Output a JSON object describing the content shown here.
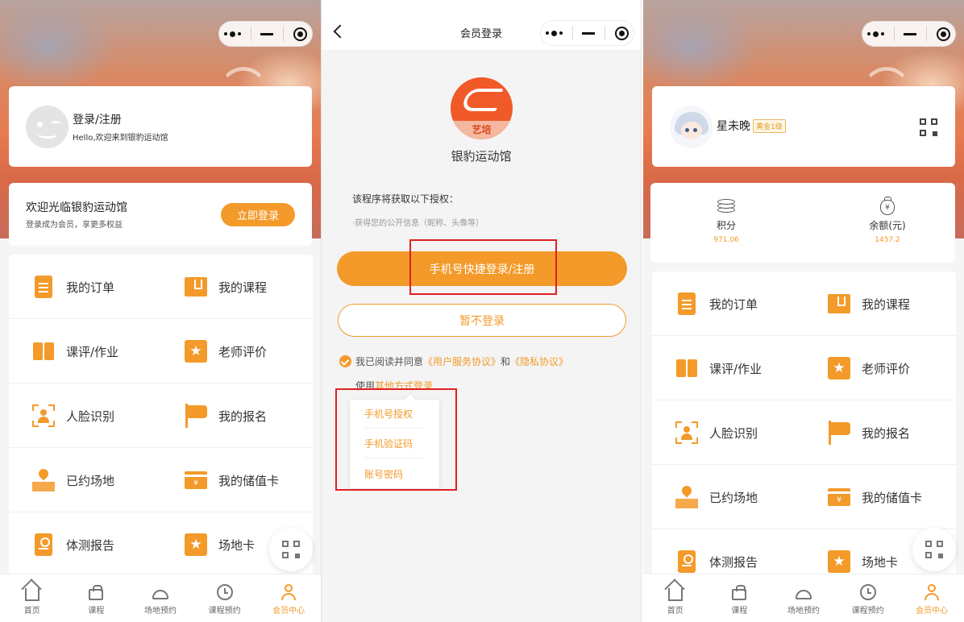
{
  "capsule": {
    "more_icon": "more-dots-icon",
    "minimize_icon": "minimize-icon",
    "close_icon": "target-close-icon"
  },
  "colors": {
    "accent": "#f39a2a",
    "highlight_box": "#e02020"
  },
  "left": {
    "user": {
      "name": "登录/注册",
      "subtitle": "Hello,欢迎来到银豹运动馆"
    },
    "welcome": {
      "title": "欢迎光临银豹运动馆",
      "subtitle": "登录成为会员，享更多权益",
      "button": "立即登录"
    }
  },
  "menu": [
    {
      "label": "我的订单",
      "icon": "order-list-icon"
    },
    {
      "label": "我的课程",
      "icon": "course-book-icon"
    },
    {
      "label": "课评/作业",
      "icon": "open-book-icon"
    },
    {
      "label": "老师评价",
      "icon": "star-icon"
    },
    {
      "label": "人脸识别",
      "icon": "face-scan-icon"
    },
    {
      "label": "我的报名",
      "icon": "flag-icon"
    },
    {
      "label": "已约场地",
      "icon": "map-pin-icon"
    },
    {
      "label": "我的储值卡",
      "icon": "card-icon"
    },
    {
      "label": "体测报告",
      "icon": "report-icon"
    },
    {
      "label": "场地卡",
      "icon": "star-card-icon"
    }
  ],
  "tabs": [
    {
      "label": "首页",
      "icon": "home-icon"
    },
    {
      "label": "课程",
      "icon": "bag-icon"
    },
    {
      "label": "场地预约",
      "icon": "venue-icon"
    },
    {
      "label": "课程预约",
      "icon": "clock-icon"
    },
    {
      "label": "会员中心",
      "icon": "user-icon"
    }
  ],
  "mid": {
    "nav_title": "会员登录",
    "logo_text": "艺培",
    "app_name": "银豹运动馆",
    "perm_title": "该程序将获取以下授权：",
    "perm_item": "·获得您的公开信息（昵称、头像等）",
    "primary_button": "手机号快捷登录/注册",
    "secondary_button": "暂不登录",
    "agree_prefix": "我已阅读并同意",
    "agree_link1": "《用户服务协议》",
    "agree_and": "和",
    "agree_link2": "《隐私协议》",
    "other_prefix": "使用",
    "other_link": "其他方式登录",
    "dropdown": [
      "手机号授权",
      "手机验证码",
      "账号密码"
    ]
  },
  "right": {
    "user": {
      "name": "星未晚",
      "badge": "黄金1级"
    },
    "stats": [
      {
        "label": "积分",
        "value": "971.06",
        "icon": "coins-icon"
      },
      {
        "label": "余额(元)",
        "value": "1457.2",
        "icon": "money-bag-icon",
        "glyph": "¥"
      }
    ]
  }
}
